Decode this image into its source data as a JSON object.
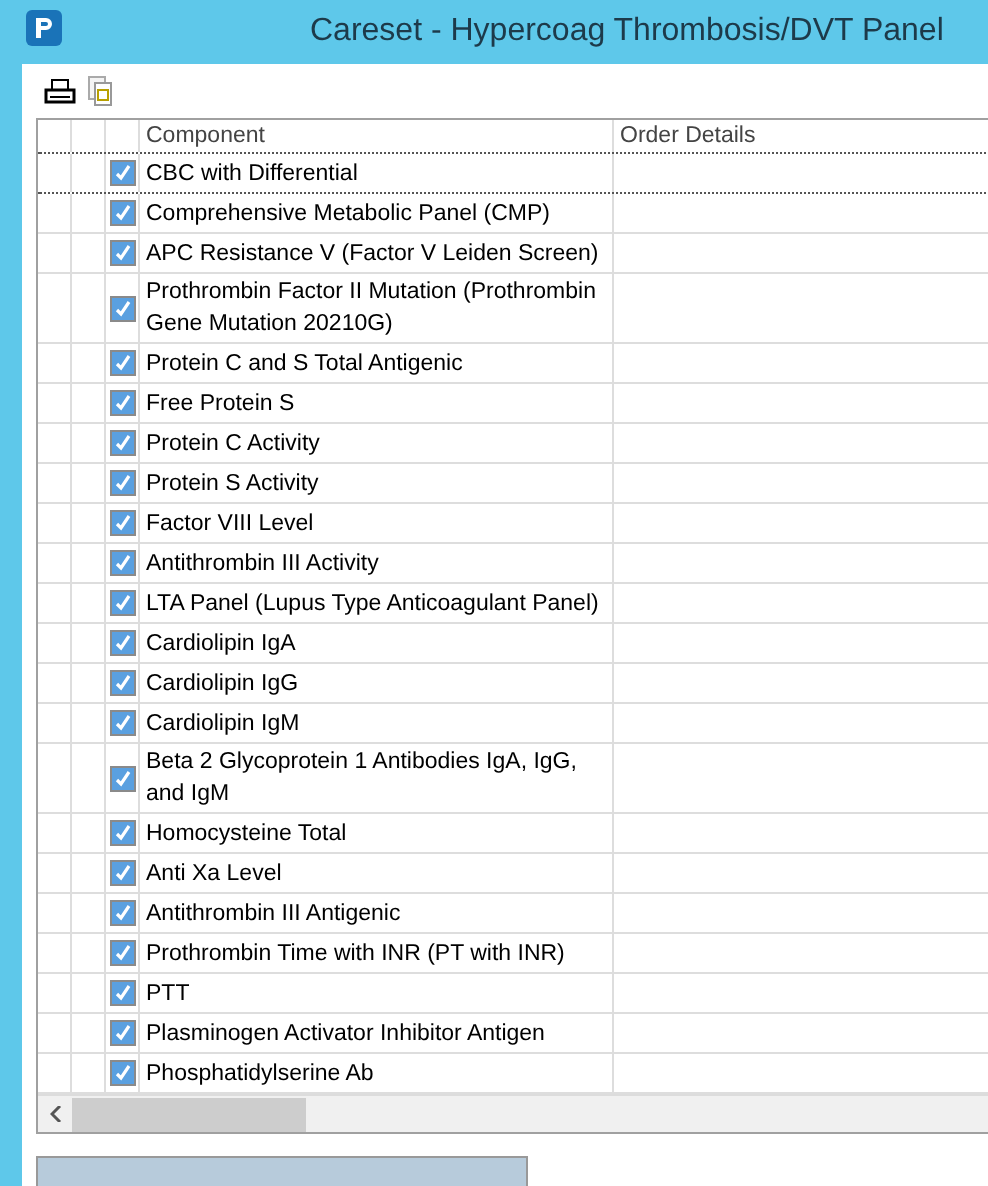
{
  "window": {
    "title": "Careset - Hypercoag Thrombosis/DVT Panel"
  },
  "table": {
    "columns": [
      "Component",
      "Order Details"
    ],
    "rows": [
      {
        "component": "CBC with Differential",
        "checked": true
      },
      {
        "component": "Comprehensive Metabolic Panel (CMP)",
        "checked": true
      },
      {
        "component": "APC Resistance V (Factor V Leiden Screen)",
        "checked": true
      },
      {
        "component": "Prothrombin Factor II Mutation (Prothrombin Gene Mutation 20210G)",
        "checked": true
      },
      {
        "component": "Protein C and S Total Antigenic",
        "checked": true
      },
      {
        "component": "Free Protein S",
        "checked": true
      },
      {
        "component": "Protein C Activity",
        "checked": true
      },
      {
        "component": "Protein S Activity",
        "checked": true
      },
      {
        "component": "Factor VIII Level",
        "checked": true
      },
      {
        "component": "Antithrombin III Activity",
        "checked": true
      },
      {
        "component": "LTA Panel (Lupus Type Anticoagulant Panel)",
        "checked": true
      },
      {
        "component": "Cardiolipin IgA",
        "checked": true
      },
      {
        "component": "Cardiolipin IgG",
        "checked": true
      },
      {
        "component": "Cardiolipin IgM",
        "checked": true
      },
      {
        "component": "Beta 2 Glycoprotein 1 Antibodies IgA, IgG, and IgM",
        "checked": true
      },
      {
        "component": "Homocysteine Total",
        "checked": true
      },
      {
        "component": "Anti Xa Level",
        "checked": true
      },
      {
        "component": "Antithrombin III Antigenic",
        "checked": true
      },
      {
        "component": "Prothrombin Time with INR (PT with INR)",
        "checked": true
      },
      {
        "component": "PTT",
        "checked": true
      },
      {
        "component": "Plasminogen Activator Inhibitor Antigen",
        "checked": true
      },
      {
        "component": "Phosphatidylserine Ab",
        "checked": true
      }
    ]
  }
}
